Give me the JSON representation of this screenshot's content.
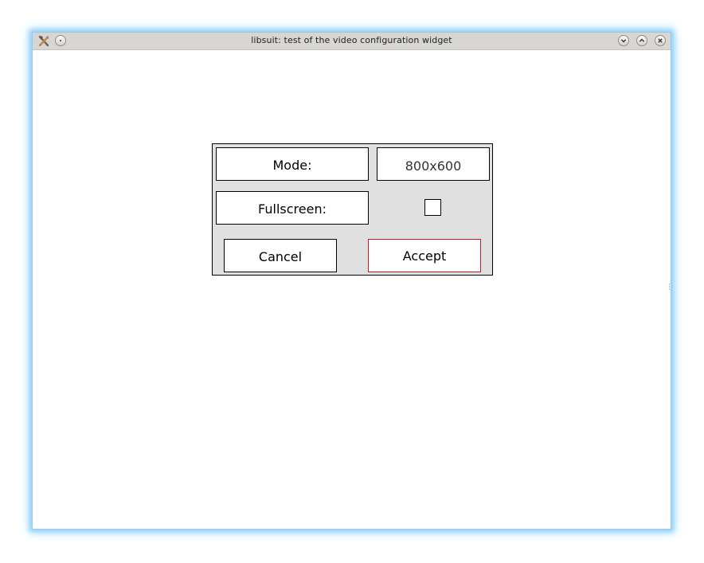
{
  "window": {
    "title": "libsuit: test of the video configuration widget",
    "titlebar_color": "#d8d6d3",
    "glow_color": "#8fd0ff",
    "left_icons": [
      "tools-icon",
      "menu-circle-icon"
    ],
    "right_icons": [
      "minimize-icon",
      "maximize-icon",
      "close-icon"
    ]
  },
  "dialog": {
    "background": "#e0e0e0",
    "mode_label": "Mode:",
    "mode_value": "800x600",
    "fullscreen_label": "Fullscreen:",
    "fullscreen_checked": false,
    "cancel_label": "Cancel",
    "accept_label": "Accept",
    "accept_border_color": "#d01818"
  }
}
